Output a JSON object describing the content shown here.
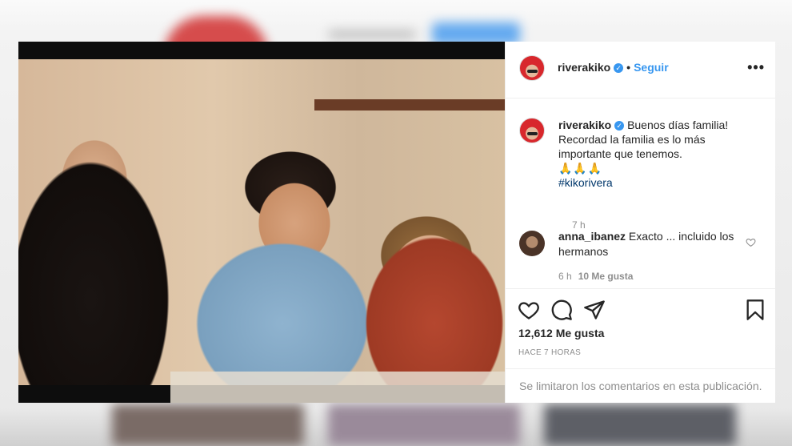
{
  "post": {
    "username": "riverakiko",
    "separator": "•",
    "follow_label": "Seguir",
    "more_label": "•••",
    "caption": {
      "username": "riverakiko",
      "text_line1": "Buenos días familia!",
      "text_line2": "Recordad la familia es lo más importante que tenemos.",
      "emojis": "🙏🙏🙏",
      "hashtag": "#kikorivera",
      "time": "7 h"
    },
    "comment": {
      "username": "anna_ibanez",
      "text": "Exacto ... incluido los hermanos",
      "time": "6 h",
      "likes": "10 Me gusta"
    },
    "likes_label": "12,612 Me gusta",
    "posted_ago": "HACE 7 HORAS",
    "comments_disabled": "Se limitaron los comentarios en esta publicación."
  },
  "icons": [
    "verified-badge-icon",
    "heart-icon",
    "comment-icon",
    "share-icon",
    "save-icon",
    "small-heart-icon"
  ],
  "colors": {
    "accent": "#3897f0",
    "text": "#262626",
    "muted": "#8e8e8e",
    "hashtag": "#00376b"
  }
}
